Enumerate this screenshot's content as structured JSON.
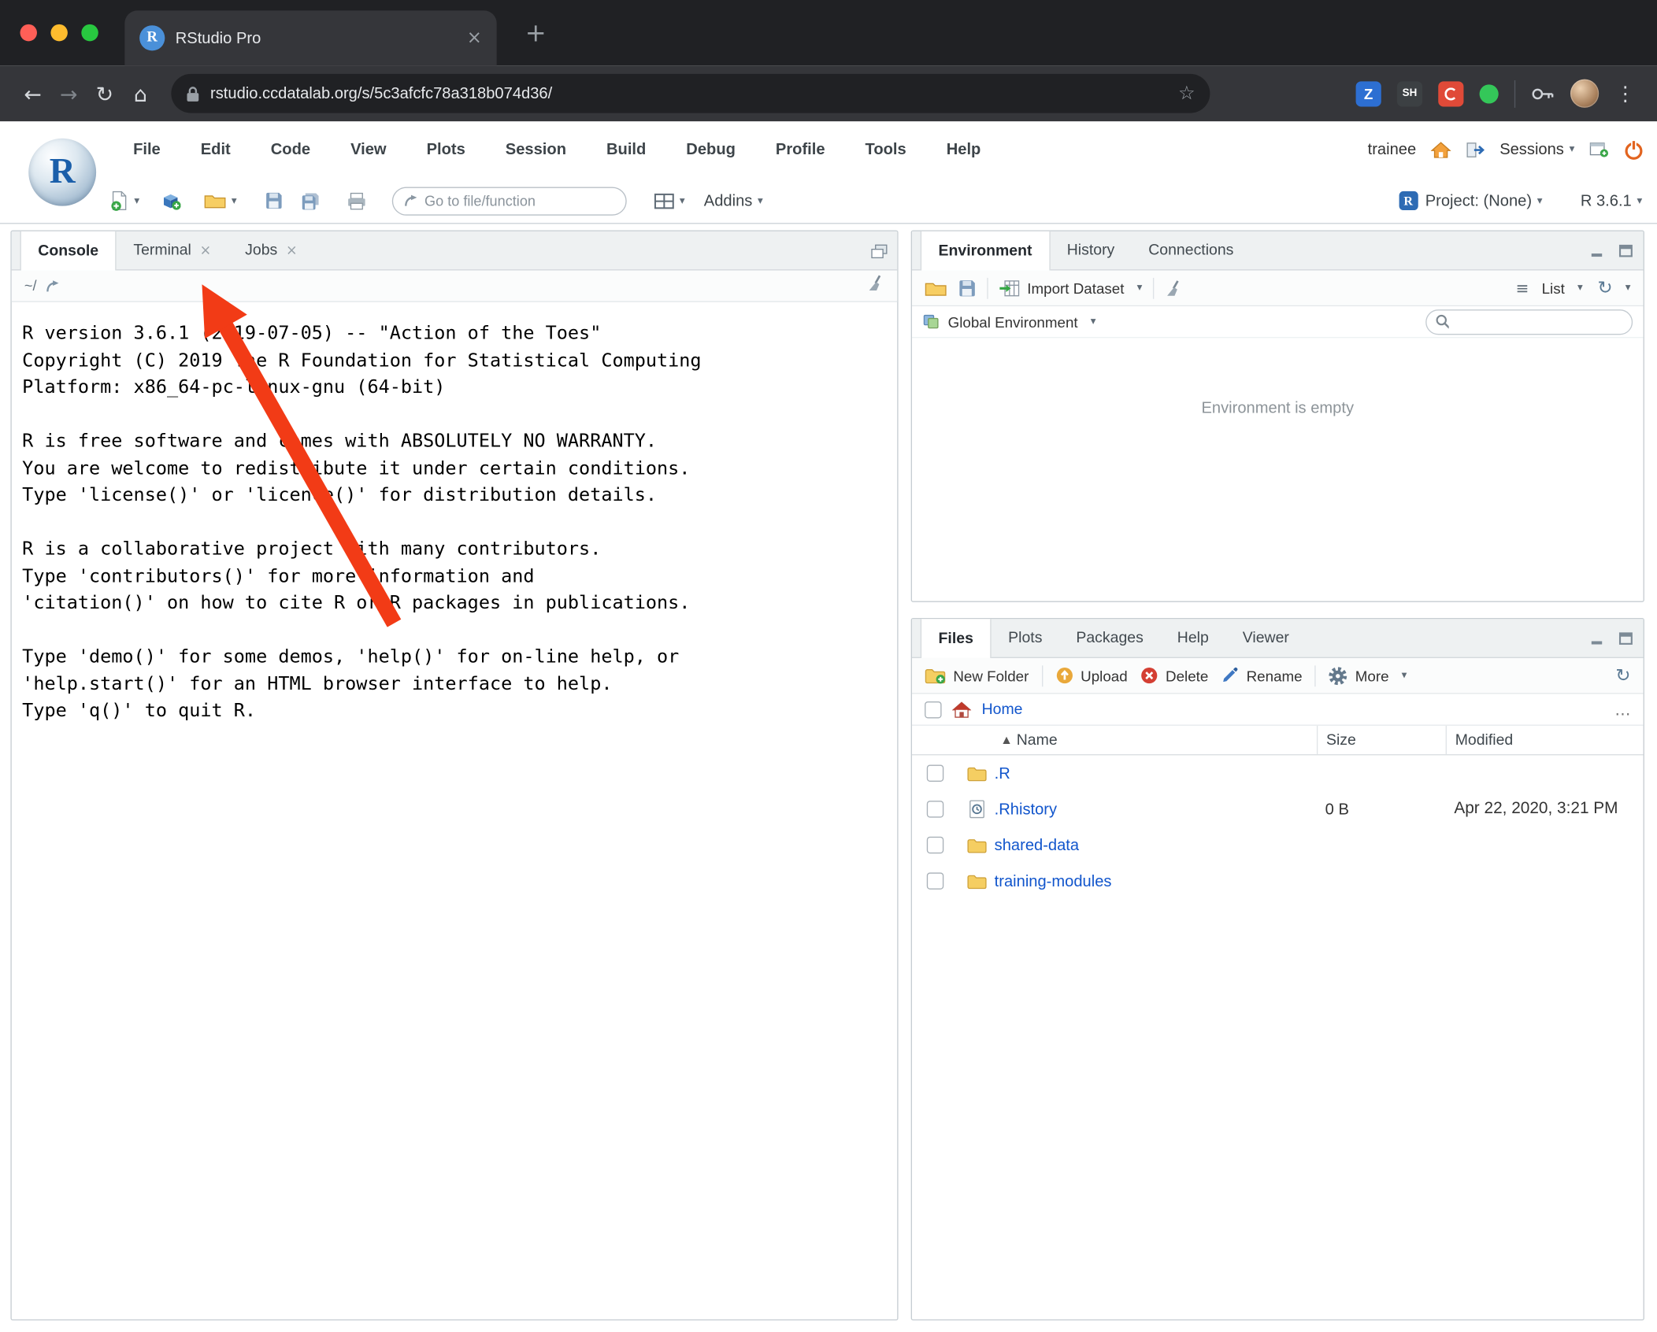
{
  "browser": {
    "tab_title": "RStudio Pro",
    "url": "rstudio.ccdatalab.org/s/5c3afcfc78a318b074d36/",
    "ext_z": "Z",
    "ext_sh": "SH"
  },
  "icons": {
    "caret": "▾",
    "back": "←",
    "forward": "→",
    "reload": "↻",
    "refresh": "↻",
    "home": "⌂",
    "star": "☆",
    "dots": "⋮",
    "close": "×",
    "plus": "+",
    "list": "≡",
    "sort": "▲",
    "ellipsis": "…",
    "r_letter": "R"
  },
  "rstudio": {
    "menus": [
      "File",
      "Edit",
      "Code",
      "View",
      "Plots",
      "Session",
      "Build",
      "Debug",
      "Profile",
      "Tools",
      "Help"
    ],
    "user": "trainee",
    "sessions": "Sessions",
    "goto_placeholder": "Go to file/function",
    "addins": "Addins",
    "project": "Project: (None)",
    "version": "R 3.6.1"
  },
  "console": {
    "tabs": [
      "Console",
      "Terminal",
      "Jobs"
    ],
    "path": "~/",
    "lines": [
      "R version 3.6.1 (2019-07-05) -- \"Action of the Toes\"",
      "Copyright (C) 2019 The R Foundation for Statistical Computing",
      "Platform: x86_64-pc-linux-gnu (64-bit)",
      "",
      "R is free software and comes with ABSOLUTELY NO WARRANTY.",
      "You are welcome to redistribute it under certain conditions.",
      "Type 'license()' or 'licence()' for distribution details.",
      "",
      "R is a collaborative project with many contributors.",
      "Type 'contributors()' for more information and",
      "'citation()' on how to cite R or R packages in publications.",
      "",
      "Type 'demo()' for some demos, 'help()' for on-line help, or",
      "'help.start()' for an HTML browser interface to help.",
      "Type 'q()' to quit R.",
      ""
    ],
    "prompt": ">"
  },
  "environment": {
    "tabs": [
      "Environment",
      "History",
      "Connections"
    ],
    "import": "Import Dataset",
    "list": "List",
    "scope": "Global Environment",
    "empty": "Environment is empty"
  },
  "files": {
    "tabs": [
      "Files",
      "Plots",
      "Packages",
      "Help",
      "Viewer"
    ],
    "new_folder": "New Folder",
    "upload": "Upload",
    "delete": "Delete",
    "rename": "Rename",
    "more": "More",
    "home": "Home",
    "col_name": "Name",
    "col_size": "Size",
    "col_modified": "Modified",
    "rows": [
      {
        "name": ".R",
        "size": "",
        "modified": ""
      },
      {
        "name": ".Rhistory",
        "size": "0 B",
        "modified": "Apr 22, 2020, 3:21 PM"
      },
      {
        "name": "shared-data",
        "size": "",
        "modified": ""
      },
      {
        "name": "training-modules",
        "size": "",
        "modified": ""
      }
    ]
  },
  "colors": {
    "annotation_arrow": "#F23B16",
    "link_blue": "#1155CC",
    "prompt_blue": "#0000CC",
    "browser_frame": "#202124",
    "browser_toolbar": "#35363A"
  }
}
